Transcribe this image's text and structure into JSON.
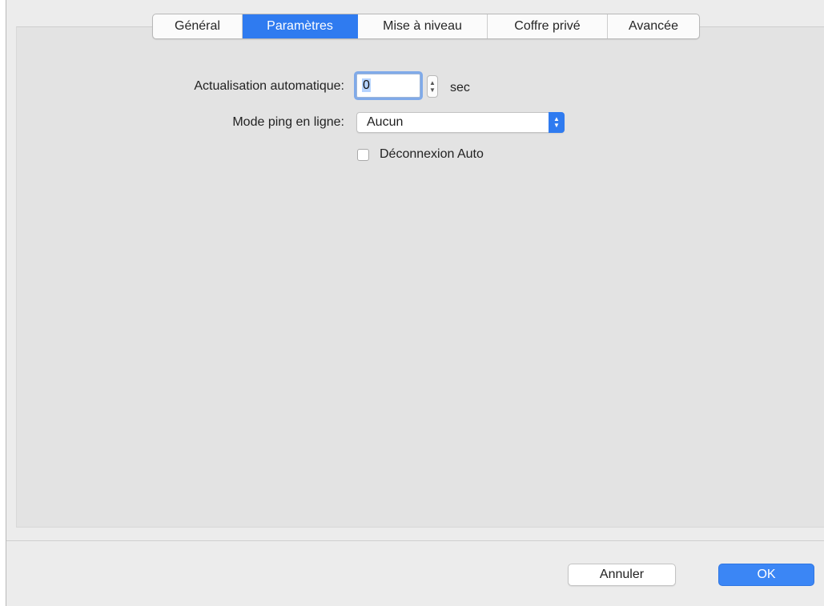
{
  "tabs": [
    {
      "label": "Général",
      "active": false
    },
    {
      "label": "Paramètres",
      "active": true
    },
    {
      "label": "Mise à niveau",
      "active": false
    },
    {
      "label": "Coffre privé",
      "active": false
    },
    {
      "label": "Avancée",
      "active": false
    }
  ],
  "settings": {
    "auto_refresh_label": "Actualisation automatique:",
    "auto_refresh_value": "0",
    "auto_refresh_unit": "sec",
    "ping_mode_label": "Mode ping en ligne:",
    "ping_mode_value": "Aucun",
    "auto_disconnect_label": "Déconnexion Auto",
    "auto_disconnect_checked": false
  },
  "buttons": {
    "cancel_label": "Annuler",
    "ok_label": "OK"
  },
  "colors": {
    "accent": "#2f7bf0",
    "window_background": "#ececec",
    "panel_background": "#e3e3e3"
  }
}
